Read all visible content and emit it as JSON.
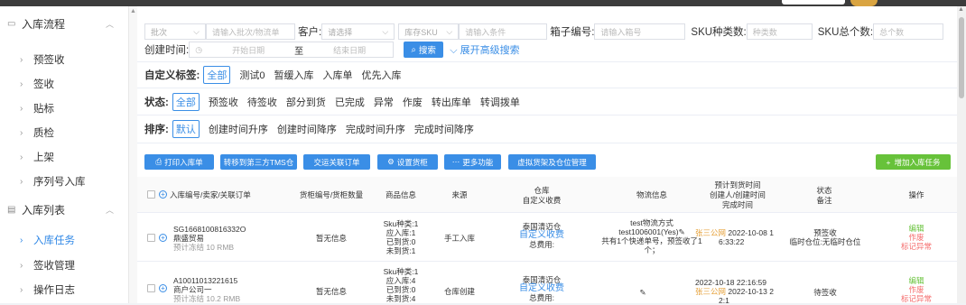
{
  "sidebar": {
    "group1": {
      "label": "入库流程"
    },
    "items1": [
      {
        "label": "预签收"
      },
      {
        "label": "签收"
      },
      {
        "label": "贴标"
      },
      {
        "label": "质检"
      },
      {
        "label": "上架"
      },
      {
        "label": "序列号入库"
      }
    ],
    "group2": {
      "label": "入库列表"
    },
    "items2": [
      {
        "label": "入库任务",
        "active": true
      },
      {
        "label": "签收管理"
      },
      {
        "label": "操作日志"
      }
    ]
  },
  "filters": {
    "batch_select": "批次",
    "batch_placeholder": "请输入批次/物流单",
    "customer_label": "客户:",
    "customer_placeholder": "请选择",
    "sku_select": "库存SKU",
    "sku_placeholder": "请输入条件",
    "box_label": "箱子编号:",
    "box_placeholder": "请输入箱号",
    "sku_types_label": "SKU种类数:",
    "sku_types_placeholder": "种类数",
    "sku_total_label": "SKU总个数:",
    "sku_total_placeholder": "总个数",
    "created_label": "创建时间:",
    "start_placeholder": "开始日期",
    "to": "至",
    "end_placeholder": "结束日期",
    "search_button": "搜索",
    "advanced_link": "展开高级搜索"
  },
  "custom_tags": {
    "title": "自定义标签:",
    "options": [
      "全部",
      "测试0",
      "暂缓入库",
      "入库单",
      "优先入库"
    ]
  },
  "status": {
    "title": "状态:",
    "options": [
      "全部",
      "预签收",
      "待签收",
      "部分到货",
      "已完成",
      "异常",
      "作废",
      "转出库单",
      "转调拨单"
    ]
  },
  "sort": {
    "title": "排序:",
    "options": [
      "默认",
      "创建时间升序",
      "创建时间降序",
      "完成时间升序",
      "完成时间降序"
    ]
  },
  "actions": {
    "print": "打印入库单",
    "transfer_tms": "转移到第三方TMS仓",
    "related_order": "交运关联订单",
    "set_cabinet": "设置货柜",
    "more": "更多功能",
    "virtual_cargo": "虚拟货架及仓位管理",
    "add_task": "增加入库任务"
  },
  "table": {
    "headers": {
      "order": "入库编号/卖家/关联订单",
      "cabinet": "货柜编号/货柜数量",
      "goods": "商品信息",
      "source": "来源",
      "warehouse": [
        "仓库",
        "自定义收费"
      ],
      "logistics": "物流信息",
      "times": [
        "预计到货时间",
        "创建人/创建时间",
        "完成时间"
      ],
      "status": [
        "状态",
        "备注"
      ],
      "ops": "操作"
    },
    "rows": [
      {
        "order_no": "SG1668100816332O",
        "seller": "鼎盛贸易",
        "frozen": "预计冻结 10 RMB",
        "cabinet": "暂无信息",
        "goods": [
          "Sku种类:1",
          "应入库:1",
          "已到货:0",
          "未到货:1"
        ],
        "source": "手工入库",
        "warehouse": "泰国清迈仓",
        "fee_link": "自定义收费",
        "fee_total": "总费用:",
        "logistics": [
          "test物流方式",
          "test1006001(Yes)",
          "共有1个快递单号，预签收了1个；"
        ],
        "creator": "张三公网",
        "created": "2022-10-08 1",
        "created2": "6:33:22",
        "expected": "",
        "status": "预签收",
        "note": "临时仓位:无临时仓位",
        "ops": [
          "编辑",
          "作废",
          "标记异常"
        ]
      },
      {
        "order_no": "A10011013221615",
        "seller": "商户公司一",
        "frozen": "预计冻结 10.2 RMB",
        "cabinet": "暂无信息",
        "goods": [
          "Sku种类:1",
          "应入库:4",
          "已到货:0",
          "未到货:4"
        ],
        "source": "仓库创建",
        "warehouse": "泰国清迈仓",
        "fee_link": "自定义收费",
        "fee_total": "总费用:",
        "logistics": [],
        "creator": "张三公网",
        "created": "2022-10-13 2",
        "created2": "2:1",
        "expected": "2022-10-18 22:16:59",
        "status": "待签收",
        "note": "",
        "ops": [
          "编辑",
          "作废",
          "标记异常"
        ]
      }
    ]
  },
  "colors": {
    "primary": "#3a8ee6",
    "success": "#67c23a",
    "warning": "#e6a23c",
    "danger": "#f56c6c"
  }
}
